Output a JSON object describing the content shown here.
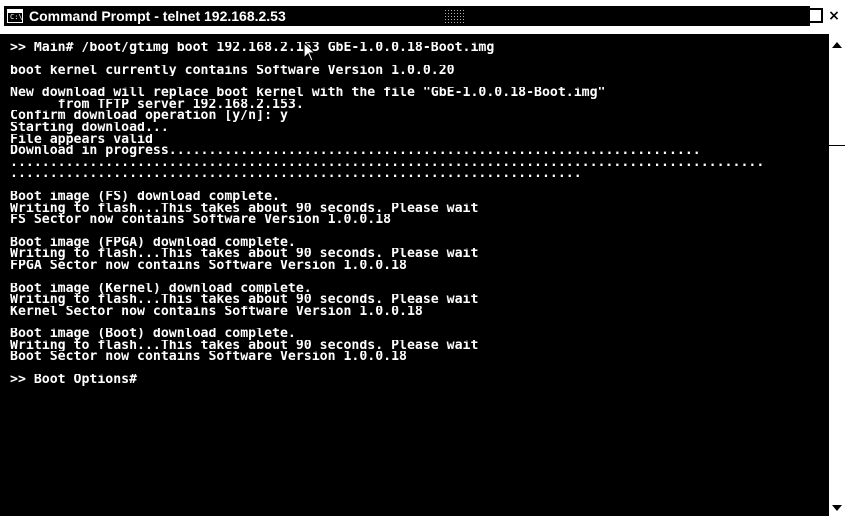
{
  "window": {
    "title": "Command Prompt - telnet 192.168.2.53",
    "icon": "console-app-icon",
    "icon_text": "C:\\",
    "controls": {
      "minimize": "_",
      "maximize": "□",
      "close": "×"
    }
  },
  "console": {
    "blocks": [
      [
        ">> Main# /boot/gtimg boot 192.168.2.153 GbE-1.0.0.18-Boot.img"
      ],
      [
        "boot kernel currently contains Software Version 1.0.0.20"
      ],
      [
        "New download will replace boot kernel with the file \"GbE-1.0.0.18-Boot.img\"",
        "      from TFTP server 192.168.2.153.",
        "Confirm download operation [y/n]: y",
        "Starting download...",
        "File appears valid",
        "Download in progress...................................................................",
        "...............................................................................................",
        "........................................................................"
      ],
      [
        "Boot image (FS) download complete.",
        "Writing to flash...This takes about 90 seconds. Please wait",
        "FS Sector now contains Software Version 1.0.0.18"
      ],
      [
        "Boot image (FPGA) download complete.",
        "Writing to flash...This takes about 90 seconds. Please wait",
        "FPGA Sector now contains Software Version 1.0.0.18"
      ],
      [
        "Boot image (Kernel) download complete.",
        "Writing to flash...This takes about 90 seconds. Please wait",
        "Kernel Sector now contains Software Version 1.0.0.18"
      ],
      [
        "Boot image (Boot) download complete.",
        "Writing to flash...This takes about 90 seconds. Please wait",
        "Boot Sector now contains Software Version 1.0.0.18"
      ],
      [
        ">> Boot Options#"
      ]
    ]
  },
  "scrollbar": {
    "up_icon": "arrow-up-icon",
    "down_icon": "arrow-down-icon"
  },
  "colors": {
    "background": "#000000",
    "text": "#ffffff",
    "chrome": "#ffffff"
  }
}
